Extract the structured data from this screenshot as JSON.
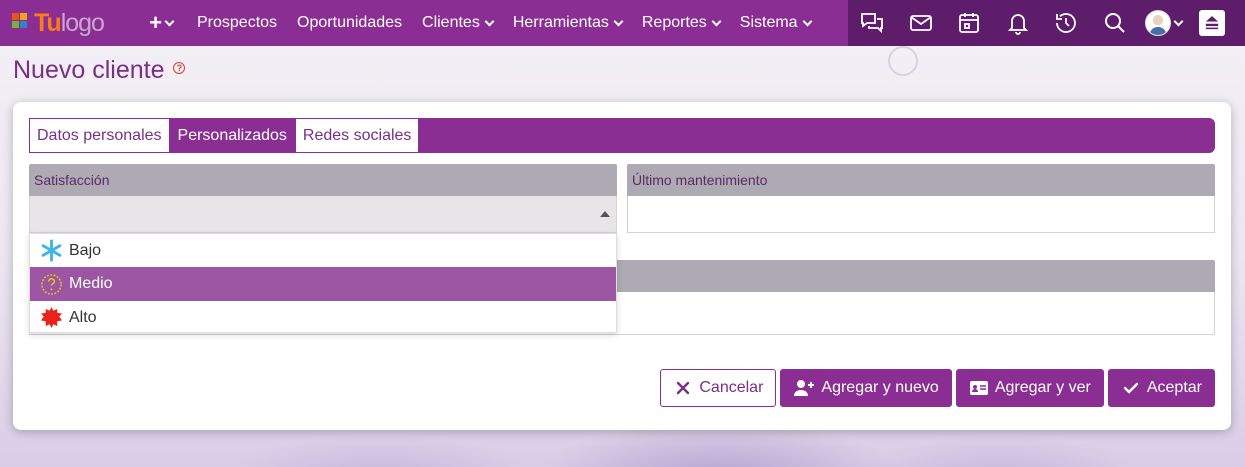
{
  "app": {
    "logo_tu": "Tu",
    "logo_text": "logo"
  },
  "nav": {
    "plus_label": "+",
    "items": [
      {
        "label": "Prospectos",
        "dropdown": false
      },
      {
        "label": "Oportunidades",
        "dropdown": false
      },
      {
        "label": "Clientes",
        "dropdown": true
      },
      {
        "label": "Herramientas",
        "dropdown": true
      },
      {
        "label": "Reportes",
        "dropdown": true
      },
      {
        "label": "Sistema",
        "dropdown": true
      }
    ],
    "right_icons": [
      "chat-icon",
      "mail-icon",
      "calendar-icon",
      "bell-icon",
      "history-icon",
      "search-icon",
      "avatar",
      "scroll-top-icon"
    ]
  },
  "page": {
    "title": "Nuevo cliente",
    "help_glyph": "?"
  },
  "tabs": [
    {
      "label": "Datos personales",
      "active": false
    },
    {
      "label": "Personalizados",
      "active": true
    },
    {
      "label": "Redes sociales",
      "active": false
    }
  ],
  "fields": {
    "satisfaccion": {
      "label": "Satisfacción",
      "value": ""
    },
    "ultimo_mantenimiento": {
      "label": "Último mantenimiento",
      "value": ""
    }
  },
  "dropdown": {
    "options": [
      {
        "label": "Bajo",
        "icon": "snowflake-icon",
        "color": "#3db3e6"
      },
      {
        "label": "Medio",
        "icon": "neutral-face-icon",
        "color": "#f0c419",
        "selected": true
      },
      {
        "label": "Alto",
        "icon": "burst-icon",
        "color": "#e8231b"
      }
    ]
  },
  "actions": {
    "cancel": "Cancelar",
    "add_new": "Agregar y nuevo",
    "add_view": "Agregar y ver",
    "accept": "Aceptar"
  },
  "colors": {
    "brand": "#8a2e93",
    "brand_dark": "#5d1d6b",
    "selected_option": "#9b55a3"
  }
}
